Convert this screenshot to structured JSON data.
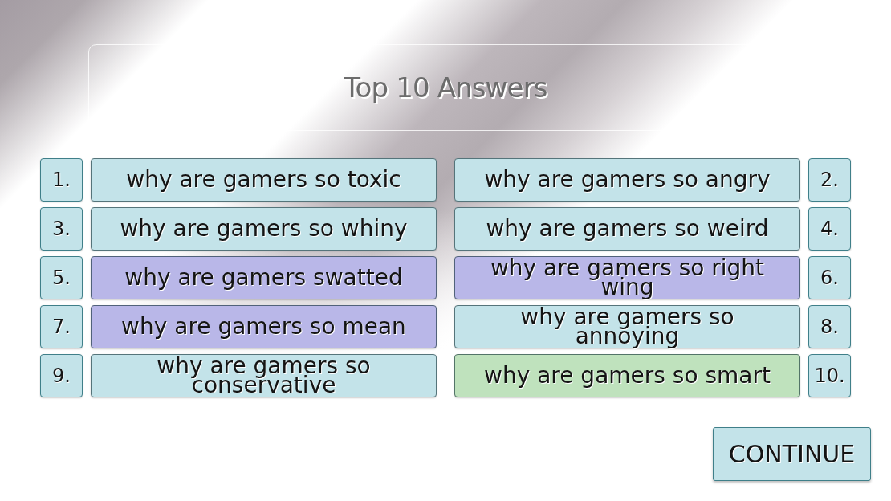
{
  "title": "Top 10 Answers",
  "answers": [
    {
      "rank": "1.",
      "text": "why are gamers so toxic",
      "color": "#c3e3e9"
    },
    {
      "rank": "2.",
      "text": "why are gamers so angry",
      "color": "#c3e3e9"
    },
    {
      "rank": "3.",
      "text": "why are gamers so whiny",
      "color": "#c3e3e9"
    },
    {
      "rank": "4.",
      "text": "why are gamers so weird",
      "color": "#c3e3e9"
    },
    {
      "rank": "5.",
      "text": "why are gamers swatted",
      "color": "#b9b7e8"
    },
    {
      "rank": "6.",
      "text": "why are gamers so right wing",
      "color": "#b9b7e8"
    },
    {
      "rank": "7.",
      "text": "why are gamers so mean",
      "color": "#b9b7e8"
    },
    {
      "rank": "8.",
      "text": "why are gamers so annoying",
      "color": "#c3e3e9"
    },
    {
      "rank": "9.",
      "text": "why are gamers so conservative",
      "color": "#c3e3e9"
    },
    {
      "rank": "10.",
      "text": "why are gamers so smart",
      "color": "#bfe2bd"
    }
  ],
  "continue_button": {
    "label": "CONTINUE"
  }
}
